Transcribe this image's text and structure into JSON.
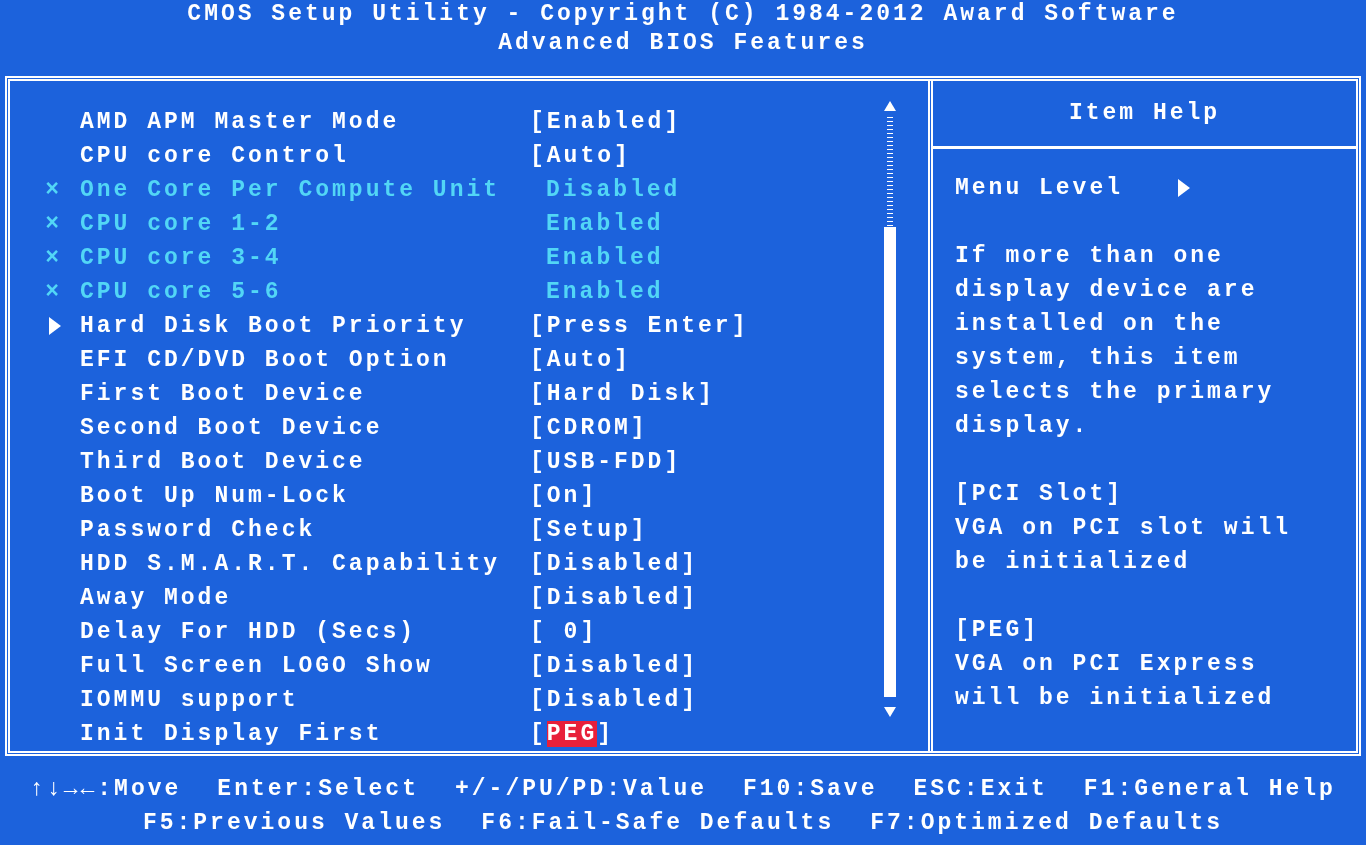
{
  "title": [
    "CMOS Setup Utility - Copyright (C) 1984-2012 Award Software",
    "Advanced BIOS Features"
  ],
  "settings": [
    {
      "kind": "option",
      "label": "AMD APM Master Mode",
      "value": "[Enabled]",
      "selected": false
    },
    {
      "kind": "option",
      "label": "CPU core Control",
      "value": "[Auto]",
      "selected": false
    },
    {
      "kind": "locked",
      "marker": "×",
      "label": "One Core Per Compute Unit",
      "value": "Disabled",
      "selected": false
    },
    {
      "kind": "locked",
      "marker": "×",
      "label": "CPU core 1-2",
      "value": "Enabled",
      "selected": false
    },
    {
      "kind": "locked",
      "marker": "×",
      "label": "CPU core 3-4",
      "value": "Enabled",
      "selected": false
    },
    {
      "kind": "locked",
      "marker": "×",
      "label": "CPU core 5-6",
      "value": "Enabled",
      "selected": false
    },
    {
      "kind": "submenu",
      "label": "Hard Disk Boot Priority",
      "value": "[Press Enter]",
      "selected": false
    },
    {
      "kind": "option",
      "label": "EFI CD/DVD Boot Option",
      "value": "[Auto]",
      "selected": false
    },
    {
      "kind": "option",
      "label": "First Boot Device",
      "value": "[Hard Disk]",
      "selected": false
    },
    {
      "kind": "option",
      "label": "Second Boot Device",
      "value": "[CDROM]",
      "selected": false
    },
    {
      "kind": "option",
      "label": "Third Boot Device",
      "value": "[USB-FDD]",
      "selected": false
    },
    {
      "kind": "option",
      "label": "Boot Up Num-Lock",
      "value": "[On]",
      "selected": false
    },
    {
      "kind": "option",
      "label": "Password Check",
      "value": "[Setup]",
      "selected": false
    },
    {
      "kind": "option",
      "label": "HDD S.M.A.R.T. Capability",
      "value": "[Disabled]",
      "selected": false
    },
    {
      "kind": "option",
      "label": "Away Mode",
      "value": "[Disabled]",
      "selected": false
    },
    {
      "kind": "option",
      "label": "Delay For HDD (Secs)",
      "value": "[ 0]",
      "selected": false
    },
    {
      "kind": "option",
      "label": "Full Screen LOGO Show",
      "value": "[Disabled]",
      "selected": false
    },
    {
      "kind": "option",
      "label": "IOMMU support",
      "value": "[Disabled]",
      "selected": false
    },
    {
      "kind": "option",
      "label": "Init Display First",
      "value": "[PEG]",
      "selected": true
    }
  ],
  "help": {
    "title": "Item Help",
    "menu_level": "Menu Level",
    "paragraphs": [
      [
        "If more than one",
        "display device are",
        "installed on the",
        "system, this item",
        "selects the primary",
        "display."
      ],
      [
        "[PCI Slot]",
        "VGA on PCI slot will",
        "be initialized"
      ],
      [
        "[PEG]",
        "VGA on PCI Express",
        "will be initialized"
      ]
    ]
  },
  "footer": [
    [
      "↑↓→←:Move",
      "Enter:Select",
      "+/-/PU/PD:Value",
      "F10:Save",
      "ESC:Exit",
      "F1:General Help"
    ],
    [
      "F5:Previous Values",
      "F6:Fail-Safe Defaults",
      "F7:Optimized Defaults"
    ]
  ]
}
